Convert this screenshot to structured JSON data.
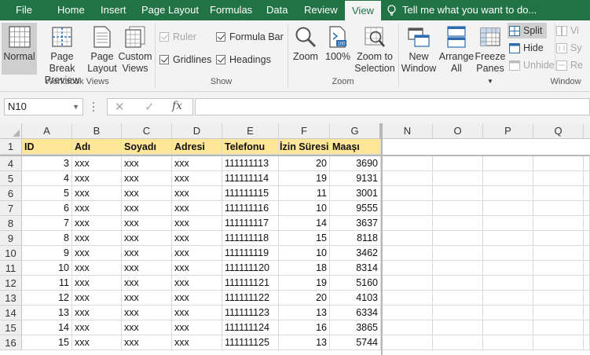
{
  "tabs": [
    "File",
    "Home",
    "Insert",
    "Page Layout",
    "Formulas",
    "Data",
    "Review",
    "View"
  ],
  "active_tab": "View",
  "tell_me": "Tell me what you want to do...",
  "ribbon": {
    "workbook_views": {
      "label": "Workbook Views",
      "normal": "Normal",
      "page_break_1": "Page Break",
      "page_break_2": "Preview",
      "page_layout_1": "Page",
      "page_layout_2": "Layout",
      "custom_views_1": "Custom",
      "custom_views_2": "Views"
    },
    "show": {
      "label": "Show",
      "ruler": "Ruler",
      "gridlines": "Gridlines",
      "formula_bar": "Formula Bar",
      "headings": "Headings"
    },
    "zoom": {
      "label": "Zoom",
      "zoom": "Zoom",
      "hundred": "100%",
      "zoom_sel_1": "Zoom to",
      "zoom_sel_2": "Selection"
    },
    "window": {
      "label": "Window",
      "new_window_1": "New",
      "new_window_2": "Window",
      "arrange_1": "Arrange",
      "arrange_2": "All",
      "freeze_1": "Freeze",
      "freeze_2": "Panes",
      "split": "Split",
      "hide": "Hide",
      "unhide": "Unhide",
      "view_side": "Vi",
      "sync": "Sy",
      "reset": "Re"
    }
  },
  "formula_bar": {
    "name_box": "N10",
    "cancel_icon": "✕",
    "enter_icon": "✓",
    "fx": "fx",
    "content": ""
  },
  "columns": [
    "A",
    "B",
    "C",
    "D",
    "E",
    "F",
    "G",
    "N",
    "O",
    "P",
    "Q"
  ],
  "header_row": {
    "row": "1",
    "cells": [
      "ID",
      "Adı",
      "Soyadı",
      "Adresi",
      "Telefonu",
      "İzin Süresi",
      "Maaşı"
    ]
  },
  "rows": [
    {
      "row": "4",
      "id": "3",
      "adi": "xxx",
      "soyadi": "xxx",
      "adresi": "xxx",
      "tel": "111111113",
      "izin": "20",
      "maas": "3690"
    },
    {
      "row": "5",
      "id": "4",
      "adi": "xxx",
      "soyadi": "xxx",
      "adresi": "xxx",
      "tel": "111111114",
      "izin": "19",
      "maas": "9131"
    },
    {
      "row": "6",
      "id": "5",
      "adi": "xxx",
      "soyadi": "xxx",
      "adresi": "xxx",
      "tel": "111111115",
      "izin": "11",
      "maas": "3001"
    },
    {
      "row": "7",
      "id": "6",
      "adi": "xxx",
      "soyadi": "xxx",
      "adresi": "xxx",
      "tel": "111111116",
      "izin": "10",
      "maas": "9555"
    },
    {
      "row": "8",
      "id": "7",
      "adi": "xxx",
      "soyadi": "xxx",
      "adresi": "xxx",
      "tel": "111111117",
      "izin": "14",
      "maas": "3637"
    },
    {
      "row": "9",
      "id": "8",
      "adi": "xxx",
      "soyadi": "xxx",
      "adresi": "xxx",
      "tel": "111111118",
      "izin": "15",
      "maas": "8118"
    },
    {
      "row": "10",
      "id": "9",
      "adi": "xxx",
      "soyadi": "xxx",
      "adresi": "xxx",
      "tel": "111111119",
      "izin": "10",
      "maas": "3462"
    },
    {
      "row": "11",
      "id": "10",
      "adi": "xxx",
      "soyadi": "xxx",
      "adresi": "xxx",
      "tel": "111111120",
      "izin": "18",
      "maas": "8314"
    },
    {
      "row": "12",
      "id": "11",
      "adi": "xxx",
      "soyadi": "xxx",
      "adresi": "xxx",
      "tel": "111111121",
      "izin": "19",
      "maas": "5160"
    },
    {
      "row": "13",
      "id": "12",
      "adi": "xxx",
      "soyadi": "xxx",
      "adresi": "xxx",
      "tel": "111111122",
      "izin": "20",
      "maas": "4103"
    },
    {
      "row": "14",
      "id": "13",
      "adi": "xxx",
      "soyadi": "xxx",
      "adresi": "xxx",
      "tel": "111111123",
      "izin": "13",
      "maas": "6334"
    },
    {
      "row": "15",
      "id": "14",
      "adi": "xxx",
      "soyadi": "xxx",
      "adresi": "xxx",
      "tel": "111111124",
      "izin": "16",
      "maas": "3865"
    },
    {
      "row": "16",
      "id": "15",
      "adi": "xxx",
      "soyadi": "xxx",
      "adresi": "xxx",
      "tel": "111111125",
      "izin": "13",
      "maas": "5744"
    }
  ],
  "colors": {
    "brand_green": "#217346",
    "header_fill": "#ffe699",
    "ribbon_bg": "#f3f3f3"
  }
}
